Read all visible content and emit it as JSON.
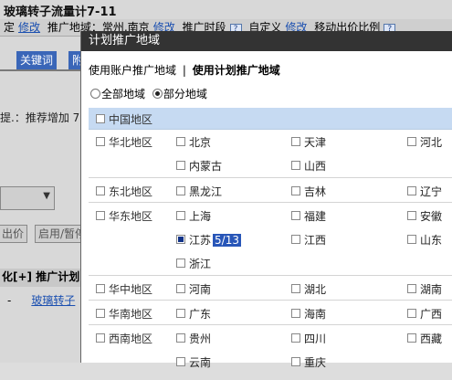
{
  "background": {
    "title": "玻璃转子流量计7-11",
    "bar_items": [
      "定",
      "修改",
      "推广地域：常州,南京",
      "修改",
      "推广时段",
      "自定义",
      "修改",
      "移动出价比例"
    ],
    "tabs": [
      "关键词",
      "附"
    ],
    "note": "提.：推荐增加 7 -",
    "buttons": [
      "出价",
      "启用/暂停"
    ],
    "table_header": "化[+] 推广计划",
    "row_dash": "-",
    "row_link": "玻璃转子"
  },
  "modal": {
    "title": "计划推广地域",
    "modes": [
      "使用账户推广地域",
      "|",
      "使用计划推广地域"
    ],
    "radio_all": "全部地域",
    "radio_partial": "部分地域",
    "china": "中国地区",
    "regions": [
      {
        "name": "华北地区",
        "cities": [
          [
            "北京",
            "天津",
            "河北"
          ],
          [
            "内蒙古",
            "山西"
          ]
        ]
      },
      {
        "name": "东北地区",
        "cities": [
          [
            "黑龙江",
            "吉林",
            "辽宁"
          ]
        ]
      },
      {
        "name": "华东地区",
        "cities": [
          [
            "上海",
            "福建",
            "安徽"
          ],
          [
            "江苏",
            "江西",
            "山东"
          ],
          [
            "浙江"
          ]
        ]
      },
      {
        "name": "华中地区",
        "cities": [
          [
            "河南",
            "湖北",
            "湖南"
          ]
        ]
      },
      {
        "name": "华南地区",
        "cities": [
          [
            "广东",
            "海南",
            "广西"
          ]
        ]
      },
      {
        "name": "西南地区",
        "cities": [
          [
            "贵州",
            "四川",
            "西藏"
          ],
          [
            "云南",
            "重庆"
          ]
        ]
      }
    ],
    "jiangsu_badge": "5/13"
  }
}
